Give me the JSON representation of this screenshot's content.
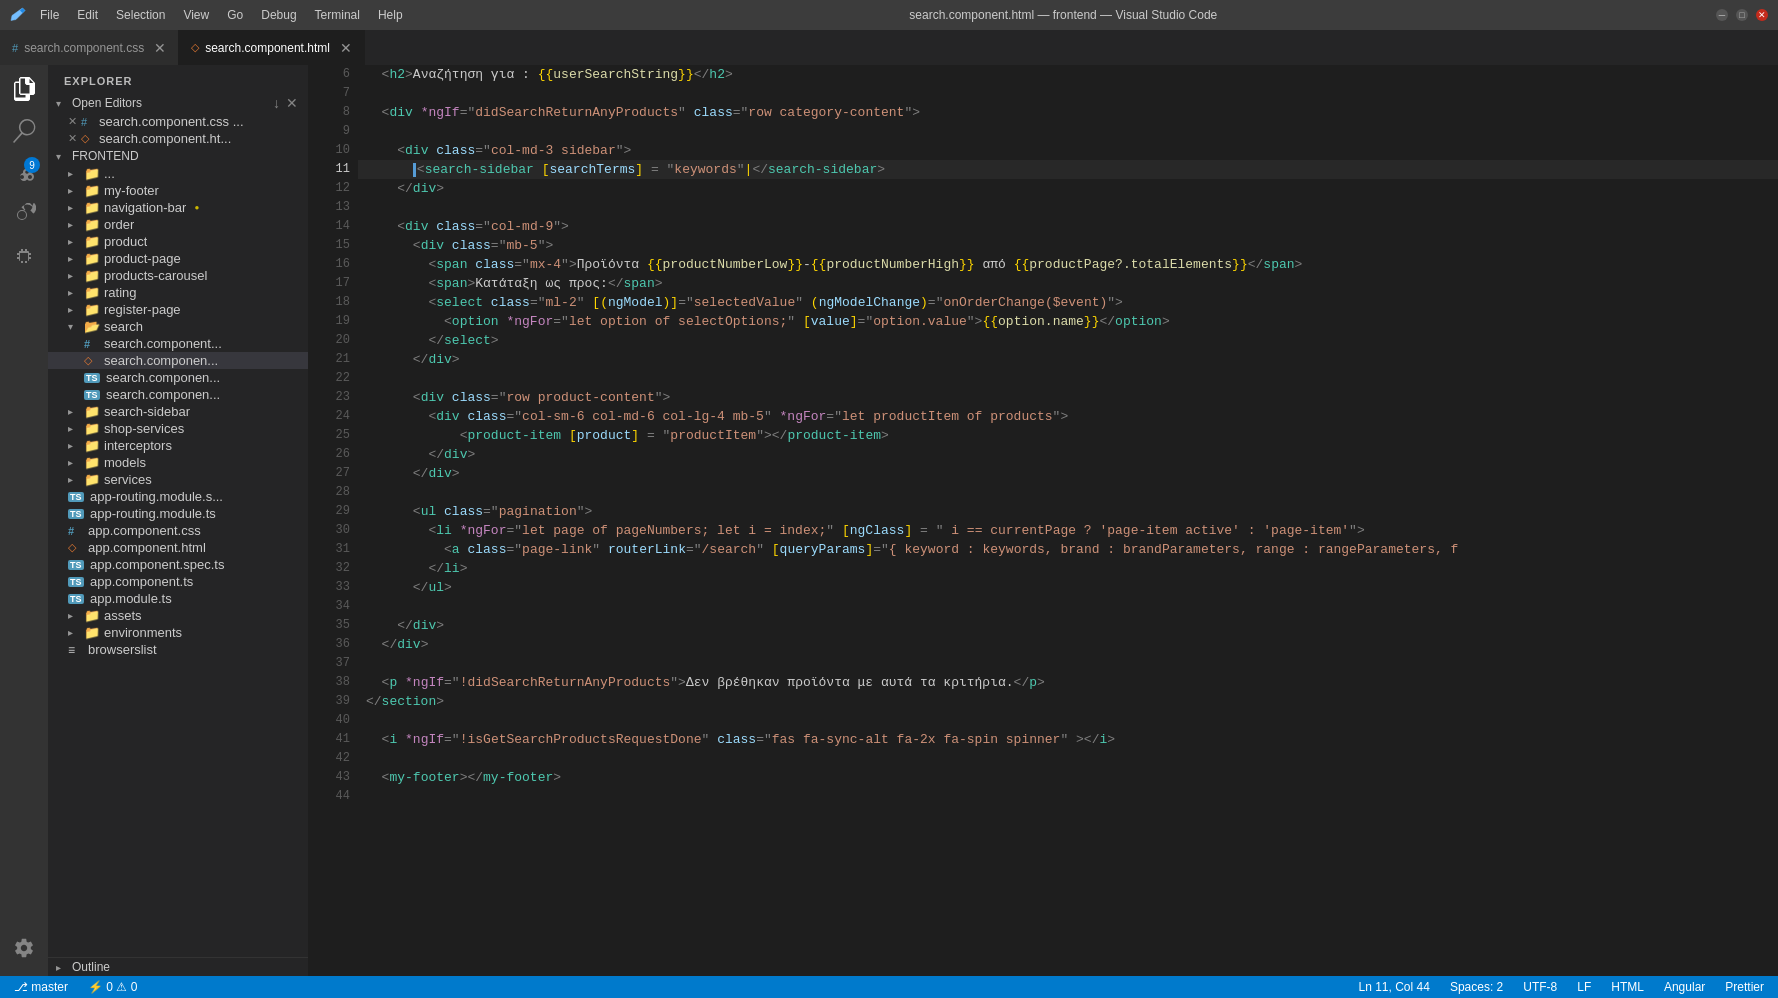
{
  "titlebar": {
    "icon": "◈",
    "menus": [
      "File",
      "Edit",
      "Selection",
      "View",
      "Go",
      "Debug",
      "Terminal",
      "Help"
    ],
    "title": "search.component.html — frontend — Visual Studio Code",
    "window_controls": [
      "─",
      "□",
      "✕"
    ]
  },
  "tabs": [
    {
      "id": "tab-css",
      "label": "search.component.css",
      "icon": "#",
      "icon_color": "#519aba",
      "active": false,
      "modified": false,
      "closeable": true
    },
    {
      "id": "tab-html",
      "label": "search.component.html",
      "icon": "◇",
      "icon_color": "#e37933",
      "active": true,
      "modified": false,
      "closeable": true
    }
  ],
  "activity_bar": {
    "icons": [
      {
        "id": "explorer",
        "symbol": "⎗",
        "active": true,
        "badge": null
      },
      {
        "id": "search",
        "symbol": "⌕",
        "active": false,
        "badge": null
      },
      {
        "id": "source-control",
        "symbol": "⑂",
        "active": false,
        "badge": 9
      },
      {
        "id": "debug",
        "symbol": "▷",
        "active": false,
        "badge": null
      },
      {
        "id": "extensions",
        "symbol": "⊞",
        "active": false,
        "badge": null
      }
    ],
    "bottom_icon": {
      "id": "settings",
      "symbol": "⚙"
    }
  },
  "sidebar": {
    "header": "Explorer",
    "top_actions": [
      "new-file",
      "new-folder",
      "refresh",
      "collapse"
    ],
    "sections": {
      "open_editors": {
        "label": "Open Editors",
        "expanded": true,
        "files": [
          {
            "name": "search.component.css ...",
            "icon": "#",
            "color": "#519aba",
            "modified": false,
            "closeable": true
          },
          {
            "name": "search.component.ht...",
            "icon": "◇",
            "color": "#e37933",
            "modified": false,
            "closeable": true
          }
        ]
      },
      "frontend": {
        "label": "FRONTEND",
        "expanded": true,
        "items": [
          {
            "type": "folder",
            "name": "...",
            "indent": 1
          },
          {
            "type": "folder",
            "name": "my-footer",
            "indent": 1,
            "expanded": false
          },
          {
            "type": "folder",
            "name": "navigation-bar",
            "indent": 1,
            "expanded": false,
            "modified": true
          },
          {
            "type": "folder",
            "name": "order",
            "indent": 1,
            "expanded": false
          },
          {
            "type": "folder",
            "name": "product",
            "indent": 1,
            "expanded": false
          },
          {
            "type": "folder",
            "name": "product-page",
            "indent": 1,
            "expanded": false
          },
          {
            "type": "folder",
            "name": "products-carousel",
            "indent": 1,
            "expanded": false
          },
          {
            "type": "folder",
            "name": "rating",
            "indent": 1,
            "expanded": false
          },
          {
            "type": "folder",
            "name": "register-page",
            "indent": 1,
            "expanded": false
          },
          {
            "type": "folder",
            "name": "search",
            "indent": 1,
            "expanded": true
          },
          {
            "type": "file",
            "name": "search.component...",
            "icon": "#",
            "color": "#519aba",
            "indent": 2
          },
          {
            "type": "file",
            "name": "search.componen...",
            "icon": "◇",
            "color": "#e37933",
            "indent": 2,
            "active": true
          },
          {
            "type": "file",
            "name": "search.componen...",
            "icon": "TS",
            "color": "#519aba",
            "indent": 2
          },
          {
            "type": "file",
            "name": "search.componen...",
            "icon": "TS",
            "color": "#519aba",
            "indent": 2
          },
          {
            "type": "folder",
            "name": "search-sidebar",
            "indent": 1,
            "expanded": false
          },
          {
            "type": "folder",
            "name": "shop-services",
            "indent": 1,
            "expanded": false
          },
          {
            "type": "folder",
            "name": "interceptors",
            "indent": 1,
            "expanded": false
          },
          {
            "type": "folder",
            "name": "models",
            "indent": 1,
            "expanded": false
          },
          {
            "type": "folder",
            "name": "services",
            "indent": 1,
            "expanded": false
          },
          {
            "type": "file",
            "name": "app-routing.module.s...",
            "icon": "TS",
            "color": "#519aba",
            "indent": 1
          },
          {
            "type": "file",
            "name": "app-routing.module.ts",
            "icon": "TS",
            "color": "#519aba",
            "indent": 1
          },
          {
            "type": "file",
            "name": "app.component.css",
            "icon": "#",
            "color": "#519aba",
            "indent": 1
          },
          {
            "type": "file",
            "name": "app.component.html",
            "icon": "◇",
            "color": "#e37933",
            "indent": 1
          },
          {
            "type": "file",
            "name": "app.component.spec.ts",
            "icon": "TS",
            "color": "#519aba",
            "indent": 1
          },
          {
            "type": "file",
            "name": "app.component.ts",
            "icon": "TS",
            "color": "#519aba",
            "indent": 1
          },
          {
            "type": "file",
            "name": "app.module.ts",
            "icon": "TS",
            "color": "#519aba",
            "indent": 1
          },
          {
            "type": "folder",
            "name": "assets",
            "indent": 1,
            "expanded": false
          },
          {
            "type": "folder",
            "name": "environments",
            "indent": 1,
            "expanded": false
          },
          {
            "type": "file",
            "name": "browserslist",
            "icon": "≡",
            "color": "#cccccc",
            "indent": 1
          }
        ]
      },
      "outline": {
        "label": "Outline",
        "expanded": false
      }
    }
  },
  "editor": {
    "filename": "search.component.html",
    "lines": [
      {
        "num": 6,
        "content": "  <h2>Αναζήτηση για : {{userSearchString}}</h2>",
        "type": "code"
      },
      {
        "num": 7,
        "content": "",
        "type": "empty"
      },
      {
        "num": 8,
        "content": "  <div *ngIf=\"didSearchReturnAnyProducts\" class=\"row category-content\">",
        "type": "code"
      },
      {
        "num": 9,
        "content": "",
        "type": "empty"
      },
      {
        "num": 10,
        "content": "    <div class=\"col-md-3 sidebar\">",
        "type": "code"
      },
      {
        "num": 11,
        "content": "      <search-sidebar [searchTerms] = \"keywords\">|</search-sidebar>",
        "type": "code",
        "active": true
      },
      {
        "num": 12,
        "content": "    </div>",
        "type": "code"
      },
      {
        "num": 13,
        "content": "",
        "type": "empty"
      },
      {
        "num": 14,
        "content": "    <div class=\"col-md-9\">",
        "type": "code"
      },
      {
        "num": 15,
        "content": "      <div class=\"mb-5\">",
        "type": "code"
      },
      {
        "num": 16,
        "content": "        <span class=\"mx-4\">Προϊόντα {{productNumberLow}}-{{productNumberHigh}} από {{productPage?.totalElements}}</span>",
        "type": "code"
      },
      {
        "num": 17,
        "content": "        <span>Κατάταξη ως προς:</span>",
        "type": "code"
      },
      {
        "num": 18,
        "content": "        <select class=\"ml-2\" [(ngModel)]=\"selectedValue\" (ngModelChange)=\"onOrderChange($event)\">",
        "type": "code"
      },
      {
        "num": 19,
        "content": "          <option *ngFor=\"let option of selectOptions;\" [value]=\"option.value\">{{option.name}}</option>",
        "type": "code"
      },
      {
        "num": 20,
        "content": "        </select>",
        "type": "code"
      },
      {
        "num": 21,
        "content": "      </div>",
        "type": "code"
      },
      {
        "num": 22,
        "content": "",
        "type": "empty"
      },
      {
        "num": 23,
        "content": "      <div class=\"row product-content\">",
        "type": "code"
      },
      {
        "num": 24,
        "content": "        <div class=\"col-sm-6 col-md-6 col-lg-4 mb-5\" *ngFor=\"let productItem of products\">",
        "type": "code"
      },
      {
        "num": 25,
        "content": "          <product-item [product] = \"productItem\"></product-item>",
        "type": "code"
      },
      {
        "num": 26,
        "content": "        </div>",
        "type": "code"
      },
      {
        "num": 27,
        "content": "      </div>",
        "type": "code"
      },
      {
        "num": 28,
        "content": "",
        "type": "empty"
      },
      {
        "num": 29,
        "content": "      <ul class=\"pagination\">",
        "type": "code"
      },
      {
        "num": 30,
        "content": "        <li *ngFor=\"let page of pageNumbers; let i = index;\" [ngClass] = \" i == currentPage ? 'page-item active' : 'page-item'\">",
        "type": "code"
      },
      {
        "num": 31,
        "content": "          <a class=\"page-link\" routerLink=\"/search\" [queryParams]=\"{ keyword : keywords, brand : brandParameters, range : rangeParameters, f",
        "type": "code"
      },
      {
        "num": 32,
        "content": "        </li>",
        "type": "code"
      },
      {
        "num": 33,
        "content": "      </ul>",
        "type": "code"
      },
      {
        "num": 34,
        "content": "",
        "type": "empty"
      },
      {
        "num": 35,
        "content": "    </div>",
        "type": "code"
      },
      {
        "num": 36,
        "content": "  </div>",
        "type": "code"
      },
      {
        "num": 37,
        "content": "",
        "type": "empty"
      },
      {
        "num": 38,
        "content": "  <p *ngIf=\"!didSearchReturnAnyProducts\">Δεν βρέθηκαν προϊόντα με αυτά τα κριτήρια.</p>",
        "type": "code"
      },
      {
        "num": 39,
        "content": "</section>",
        "type": "code"
      },
      {
        "num": 40,
        "content": "",
        "type": "empty"
      },
      {
        "num": 41,
        "content": "  <i *ngIf=\"!isGetSearchProductsRequestDone\" class=\"fas fa-sync-alt fa-2x fa-spin spinner\" ></i>",
        "type": "code"
      },
      {
        "num": 42,
        "content": "",
        "type": "empty"
      },
      {
        "num": 43,
        "content": "  <my-footer></my-footer>",
        "type": "code"
      },
      {
        "num": 44,
        "content": "",
        "type": "empty"
      }
    ]
  },
  "statusbar": {
    "left": [
      "⎇ master",
      "⚡ 0",
      "⚠ 0"
    ],
    "right": [
      "Ln 11, Col 44",
      "Spaces: 2",
      "UTF-8",
      "LF",
      "HTML",
      "Angular",
      "Prettier"
    ]
  }
}
